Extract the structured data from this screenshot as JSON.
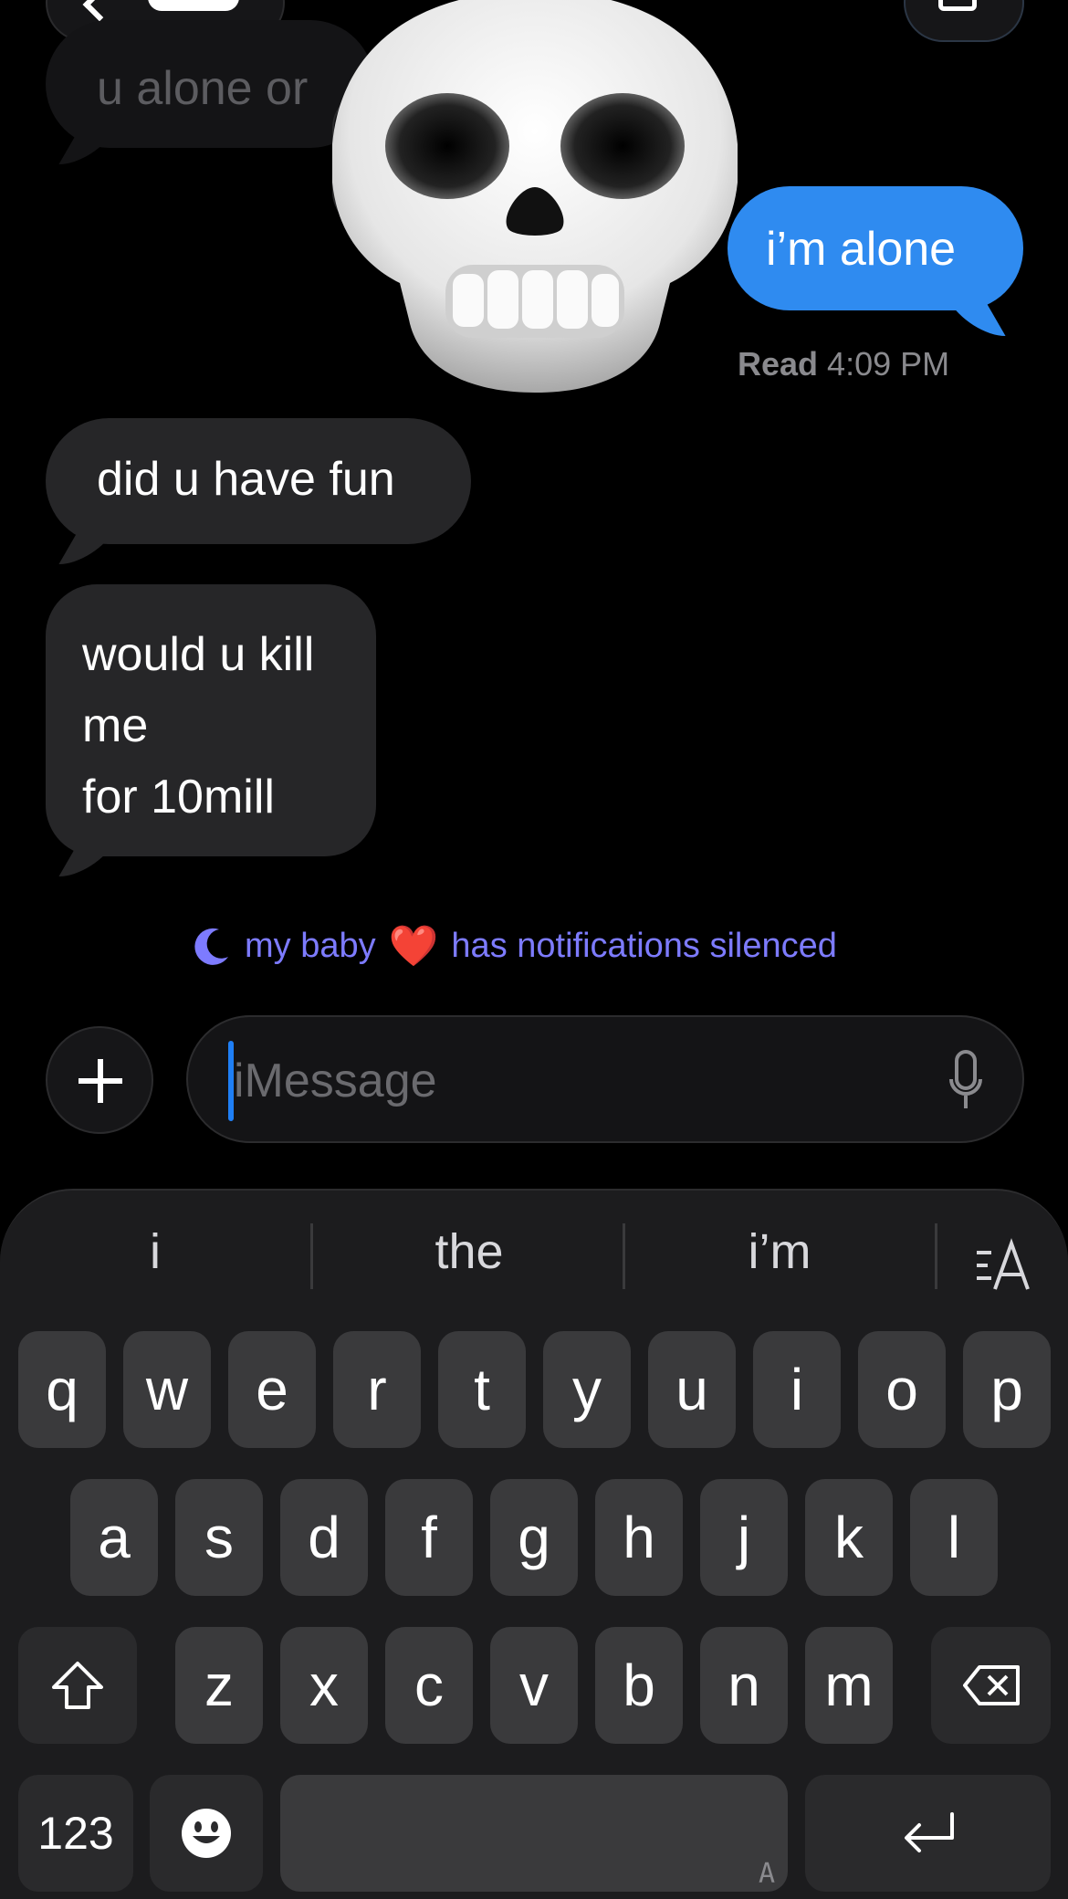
{
  "messages": {
    "partial_incoming": "u alone or",
    "outgoing": "i’m alone",
    "read_label": "Read",
    "read_time": "4:09 PM",
    "incoming_1": "did u have fun",
    "incoming_2_lines": [
      "would u kill",
      "me",
      "for 10mill"
    ]
  },
  "silenced": {
    "name": "my baby",
    "emoji": "❤️",
    "text": "has notifications silenced",
    "accent": "#7d7bff"
  },
  "compose": {
    "placeholder": "iMessage"
  },
  "keyboard": {
    "suggestions": [
      "i",
      "the",
      "i’m"
    ],
    "row1": [
      "q",
      "w",
      "e",
      "r",
      "t",
      "y",
      "u",
      "i",
      "o",
      "p"
    ],
    "row2": [
      "a",
      "s",
      "d",
      "f",
      "g",
      "h",
      "j",
      "k",
      "l"
    ],
    "row3": [
      "z",
      "x",
      "c",
      "v",
      "b",
      "n",
      "m"
    ],
    "numbers_label": "123",
    "space_hint": "A"
  },
  "colors": {
    "outgoing_bubble": "#2f8bf0",
    "incoming_bubble": "#262628",
    "background": "#000000"
  }
}
